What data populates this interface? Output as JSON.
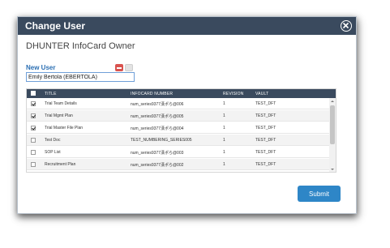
{
  "dialog": {
    "title": "Change User",
    "subtitle": "DHUNTER InfoCard Owner",
    "field_label": "New User",
    "user_value": "Emily Bertola (EBERTOLA)",
    "submit_label": "Submit"
  },
  "table": {
    "headers": [
      "TITLE",
      "INFOCARD NUMBER",
      "REVISION",
      "VAULT"
    ],
    "rows": [
      {
        "checked": true,
        "title": "Trial Team Details",
        "number": "num_series9377漢ポら@006",
        "revision": "1",
        "vault": "TEST_DFT"
      },
      {
        "checked": true,
        "title": "Trial Mgmt Plan",
        "number": "num_series9377漢ポら@005",
        "revision": "1",
        "vault": "TEST_DFT"
      },
      {
        "checked": true,
        "title": "Trial Master File Plan",
        "number": "num_series9377漢ポら@004",
        "revision": "1",
        "vault": "TEST_DFT"
      },
      {
        "checked": false,
        "title": "Test Doc",
        "number": "TEST_NUMBERING_SERIES005",
        "revision": "1",
        "vault": "TEST_DFT"
      },
      {
        "checked": false,
        "title": "SOP List",
        "number": "num_series9377漢ポら@003",
        "revision": "1",
        "vault": "TEST_DFT"
      },
      {
        "checked": false,
        "title": "Recruitment Plan",
        "number": "num_series9377漢ポら@002",
        "revision": "1",
        "vault": "TEST_DFT"
      }
    ]
  },
  "colors": {
    "titlebar": "#3a4a5e",
    "accent": "#2b6fb3",
    "submit": "#2e86c7",
    "remove": "#d9534f"
  },
  "icons": {
    "close": "close-circle-icon",
    "remove": "minus-icon",
    "checkbox": "checkbox-icon"
  }
}
